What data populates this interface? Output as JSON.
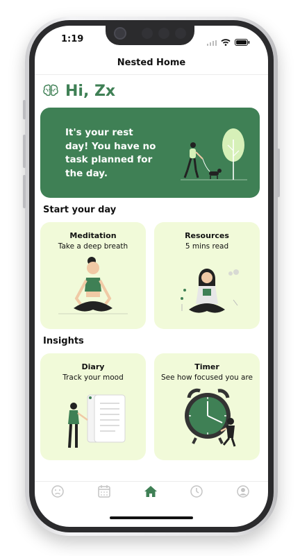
{
  "status": {
    "time": "1:19"
  },
  "nav": {
    "title": "Nested Home"
  },
  "greeting": {
    "text": "Hi, Zx"
  },
  "banner": {
    "message": "It's your rest day! You have no task planned for the day."
  },
  "sections": {
    "start": "Start your day",
    "insights": "Insights"
  },
  "cards": {
    "meditation": {
      "title": "Meditation",
      "subtitle": "Take a deep breath"
    },
    "resources": {
      "title": "Resources",
      "subtitle": "5 mins read"
    },
    "diary": {
      "title": "Diary",
      "subtitle": "Track your mood"
    },
    "timer": {
      "title": "Timer",
      "subtitle": "See how focused you are"
    }
  },
  "tabs": [
    {
      "icon": "mood-icon"
    },
    {
      "icon": "calendar-icon"
    },
    {
      "icon": "home-icon",
      "active": true
    },
    {
      "icon": "clock-icon"
    },
    {
      "icon": "profile-icon"
    }
  ],
  "colors": {
    "accent": "#3f8055",
    "card": "#f1fad9",
    "inactive_icon": "#c4c4c4"
  }
}
